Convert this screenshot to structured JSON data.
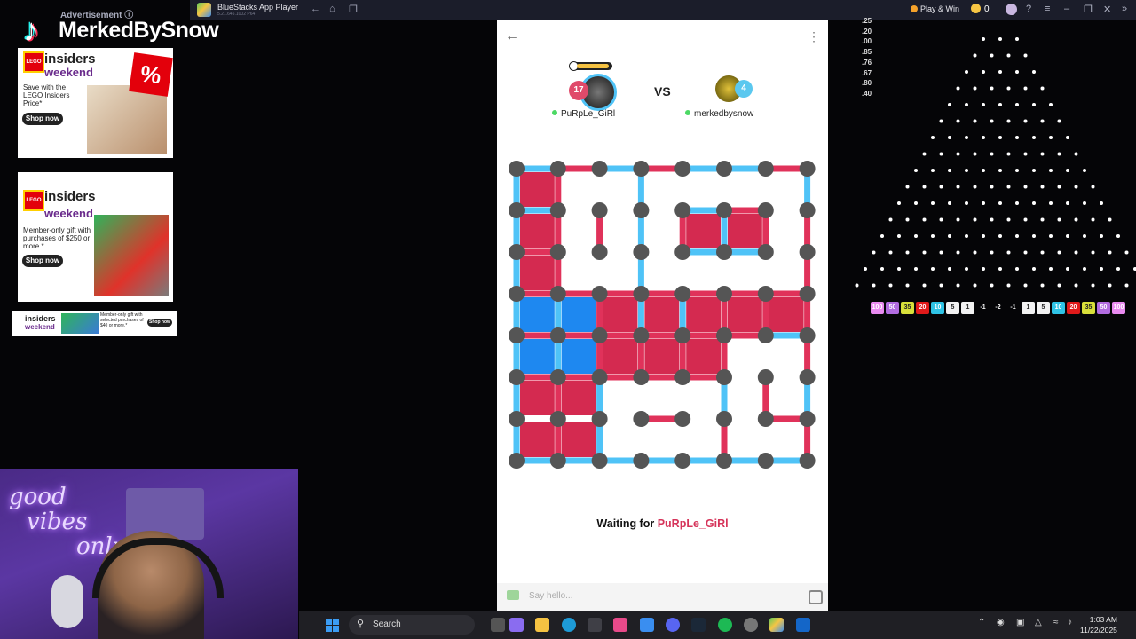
{
  "titlebar": {
    "app_title": "BlueStacks App Player",
    "app_version": "5.21.645.1002  P64",
    "play_win": "Play & Win",
    "coins": "0"
  },
  "ads": {
    "label": "Advertisement ⓘ",
    "ad1": {
      "brand": "insiders",
      "weekend": "weekend",
      "desc": "Save with the LEGO Insiders Price*",
      "cta": "Shop now",
      "tag": "%"
    },
    "ad2": {
      "brand": "insiders",
      "weekend": "weekend",
      "desc": "Member-only gift with purchases of $250 or more.*",
      "cta": "Shop now"
    },
    "ad3": {
      "brand": "insiders",
      "weekend": "weekend",
      "desc": "Member-only gift with selected purchases of $40 or more.*",
      "cta": "Shop now"
    }
  },
  "overlay": {
    "tiktok_name": "MerkedBySnow"
  },
  "webcam": {
    "neon_text": [
      "good",
      "vibes",
      "only"
    ]
  },
  "game": {
    "player1": {
      "name": "PuRpLe_GiRl",
      "score": "17",
      "color": "#e04a6a"
    },
    "vs_label": "VS",
    "player2": {
      "name": "merkedbysnow",
      "score": "4",
      "color": "#5bc8ef"
    },
    "waiting_prefix": "Waiting for ",
    "waiting_player": "PuRpLe_GiRl",
    "chat_placeholder": "Say hello...",
    "colors": {
      "red": "#e0325a",
      "blue": "#4fc3f7",
      "dot": "#555555",
      "red_box": "#d42a50",
      "blue_box": "#1e88f0"
    }
  },
  "plinko": {
    "odds": [
      ".25",
      ".20",
      ".00",
      ".85",
      ".76",
      ".67",
      ".80",
      ".40"
    ],
    "slots": [
      {
        "v": "100",
        "c": "#e98bf0"
      },
      {
        "v": "50",
        "c": "#b26ce0"
      },
      {
        "v": "35",
        "c": "#d8e03a"
      },
      {
        "v": "20",
        "c": "#e01a1a"
      },
      {
        "v": "10",
        "c": "#2fc4e6"
      },
      {
        "v": "5",
        "c": "#f2f2f2"
      },
      {
        "v": "1",
        "c": "#f2f2f2"
      },
      {
        "v": "-1",
        "c": "transparent"
      },
      {
        "v": "-2",
        "c": "transparent"
      },
      {
        "v": "-1",
        "c": "transparent"
      },
      {
        "v": "1",
        "c": "#f2f2f2"
      },
      {
        "v": "5",
        "c": "#f2f2f2"
      },
      {
        "v": "10",
        "c": "#2fc4e6"
      },
      {
        "v": "20",
        "c": "#e01a1a"
      },
      {
        "v": "35",
        "c": "#d8e03a"
      },
      {
        "v": "50",
        "c": "#b26ce0"
      },
      {
        "v": "100",
        "c": "#e98bf0"
      }
    ]
  },
  "taskbar": {
    "search_label": "Search",
    "time": "1:03 AM",
    "date": "11/22/2025"
  }
}
